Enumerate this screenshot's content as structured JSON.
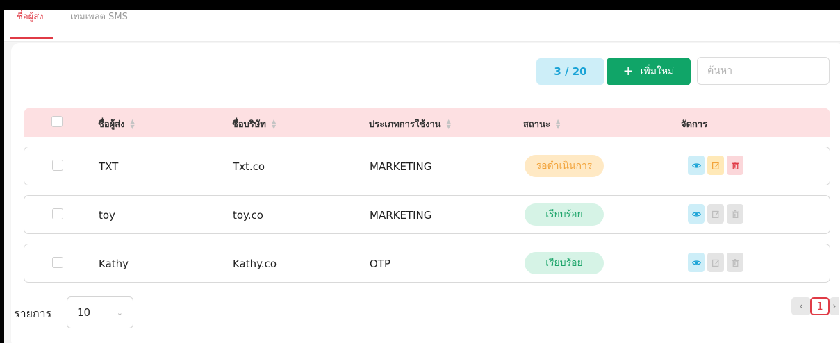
{
  "tabs": [
    {
      "label": "ชื่อผู้ส่ง",
      "active": true
    },
    {
      "label": "เทมเพลต SMS",
      "active": false
    }
  ],
  "toolbar": {
    "counter": "3 / 20",
    "add_icon": "+",
    "add_label": "เพิ่มใหม่",
    "search_placeholder": "ค้นหา"
  },
  "table": {
    "columns": [
      "ชื่อผู้ส่ง",
      "ชื่อบริษัท",
      "ประเภทการใช้งาน",
      "สถานะ",
      "จัดการ"
    ],
    "rows": [
      {
        "sender": "TXT",
        "company": "Txt.co",
        "usage": "MARKETING",
        "status": "รอดำเนินการ",
        "status_type": "pending"
      },
      {
        "sender": "toy",
        "company": "toy.co",
        "usage": "MARKETING",
        "status": "เรียบร้อย",
        "status_type": "done"
      },
      {
        "sender": "Kathy",
        "company": "Kathy.co",
        "usage": "OTP",
        "status": "เรียบร้อย",
        "status_type": "done"
      }
    ]
  },
  "footer": {
    "rows_label": "รายการ",
    "page_size": "10",
    "current_page": "1"
  },
  "colors": {
    "accent": "#e03b46",
    "primary_button": "#10a568",
    "header_bg": "#fde0e2",
    "pending_bg": "#ffe9c4",
    "done_bg": "#d6f3e6"
  }
}
